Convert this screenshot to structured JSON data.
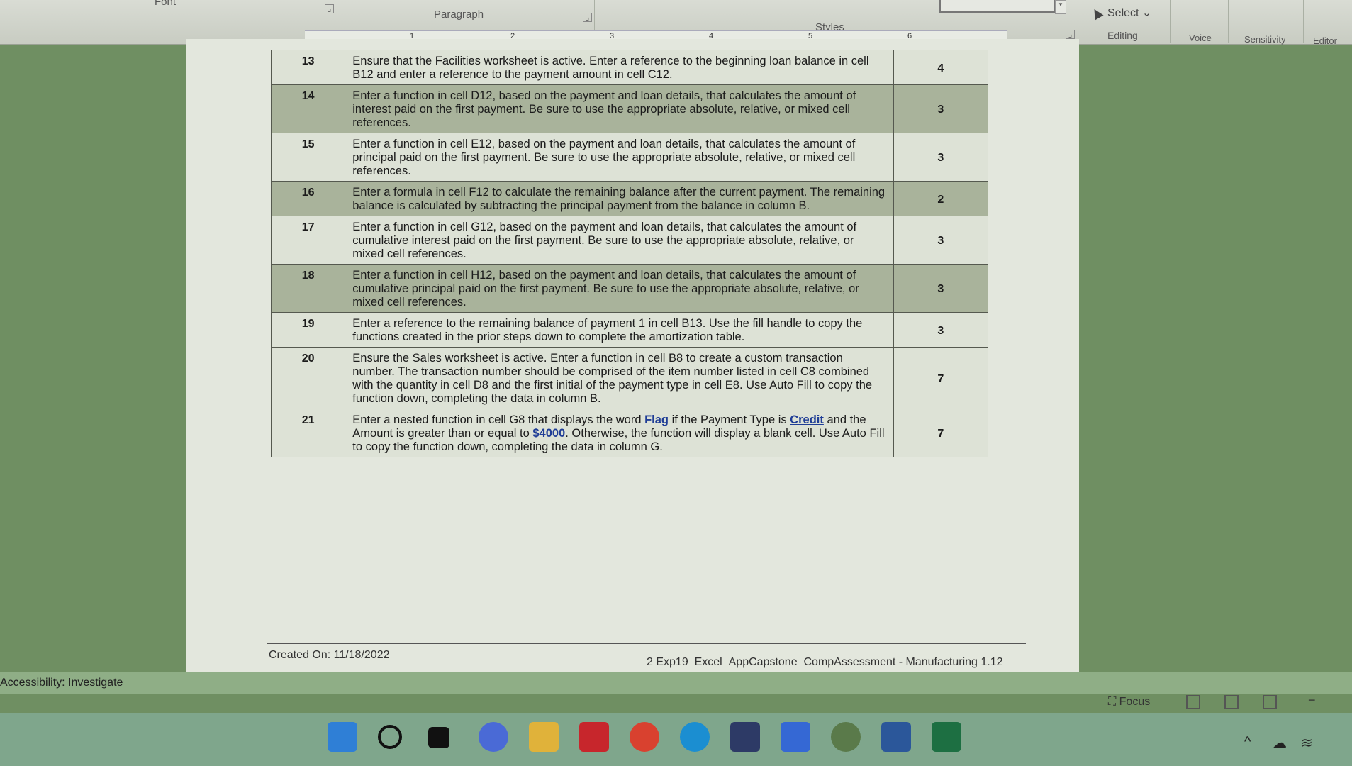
{
  "ribbon": {
    "font_group": "Font",
    "paragraph_group": "Paragraph",
    "styles_group": "Styles",
    "select_label": "Select",
    "editing_label": "Editing",
    "voice_label": "Voice",
    "sensitivity_label": "Sensitivity",
    "editor_label": "Editor"
  },
  "ruler": {
    "marks": [
      "1",
      "2",
      "3",
      "4",
      "5",
      "6"
    ]
  },
  "table": {
    "rows": [
      {
        "num": "13",
        "text": "Ensure that the Facilities worksheet is active. Enter a reference to the beginning loan balance in cell B12 and enter a reference to the payment amount in cell C12.",
        "points": "4"
      },
      {
        "num": "14",
        "text": "Enter a function in cell D12, based on the payment and loan details, that calculates the amount of interest paid on the first payment. Be sure to use the appropriate absolute, relative, or mixed cell references.",
        "points": "3"
      },
      {
        "num": "15",
        "text": "Enter a function in cell E12, based on the payment and loan details, that calculates the amount of principal paid on the first payment. Be sure to use the appropriate absolute, relative, or mixed cell references.",
        "points": "3"
      },
      {
        "num": "16",
        "text": "Enter a formula in cell F12 to calculate the remaining balance after the current payment. The remaining balance is calculated by subtracting the principal payment from the balance in column B.",
        "points": "2"
      },
      {
        "num": "17",
        "text": "Enter a function in cell G12, based on the payment and loan details, that calculates the amount of cumulative interest paid on the first payment. Be sure to use the appropriate absolute, relative, or mixed cell references.",
        "points": "3"
      },
      {
        "num": "18",
        "text": "Enter a function in cell H12, based on the payment and loan details, that calculates the amount of cumulative principal paid on the first payment. Be sure to use the appropriate absolute, relative, or mixed cell references.",
        "points": "3"
      },
      {
        "num": "19",
        "text": "Enter a reference to the remaining balance of payment 1 in cell B13. Use the fill handle to copy the functions created in the prior steps down to complete the amortization table.",
        "points": "3"
      },
      {
        "num": "20",
        "text": "Ensure the Sales worksheet is active. Enter a function in cell B8 to create a custom transaction number. The transaction number should be comprised of the item number listed in cell C8 combined with the quantity in cell D8 and the first initial of the payment type in cell E8. Use Auto Fill to copy the function down, completing the data in column B.",
        "points": "7"
      }
    ],
    "row21": {
      "num": "21",
      "part1": "Enter a nested function in cell G8 that displays the word ",
      "flag": "Flag",
      "part2": " if the Payment Type is ",
      "credit": "Credit",
      "part3": " and the Amount is greater than or equal to ",
      "amount": "$4000",
      "part4": ". Otherwise, the function will display a blank cell. Use Auto Fill to copy the function down, completing the data in column G.",
      "points": "7"
    }
  },
  "footer": {
    "created": "Created On: 11/18/2022",
    "page_info": "2  Exp19_Excel_AppCapstone_CompAssessment - Manufacturing 1.12"
  },
  "status": {
    "accessibility": "Accessibility: Investigate",
    "focus": "Focus"
  },
  "colors": {
    "word_blue": "#2b579a",
    "excel_green": "#1d6f42",
    "highlight_blue": "#1f3d96"
  }
}
